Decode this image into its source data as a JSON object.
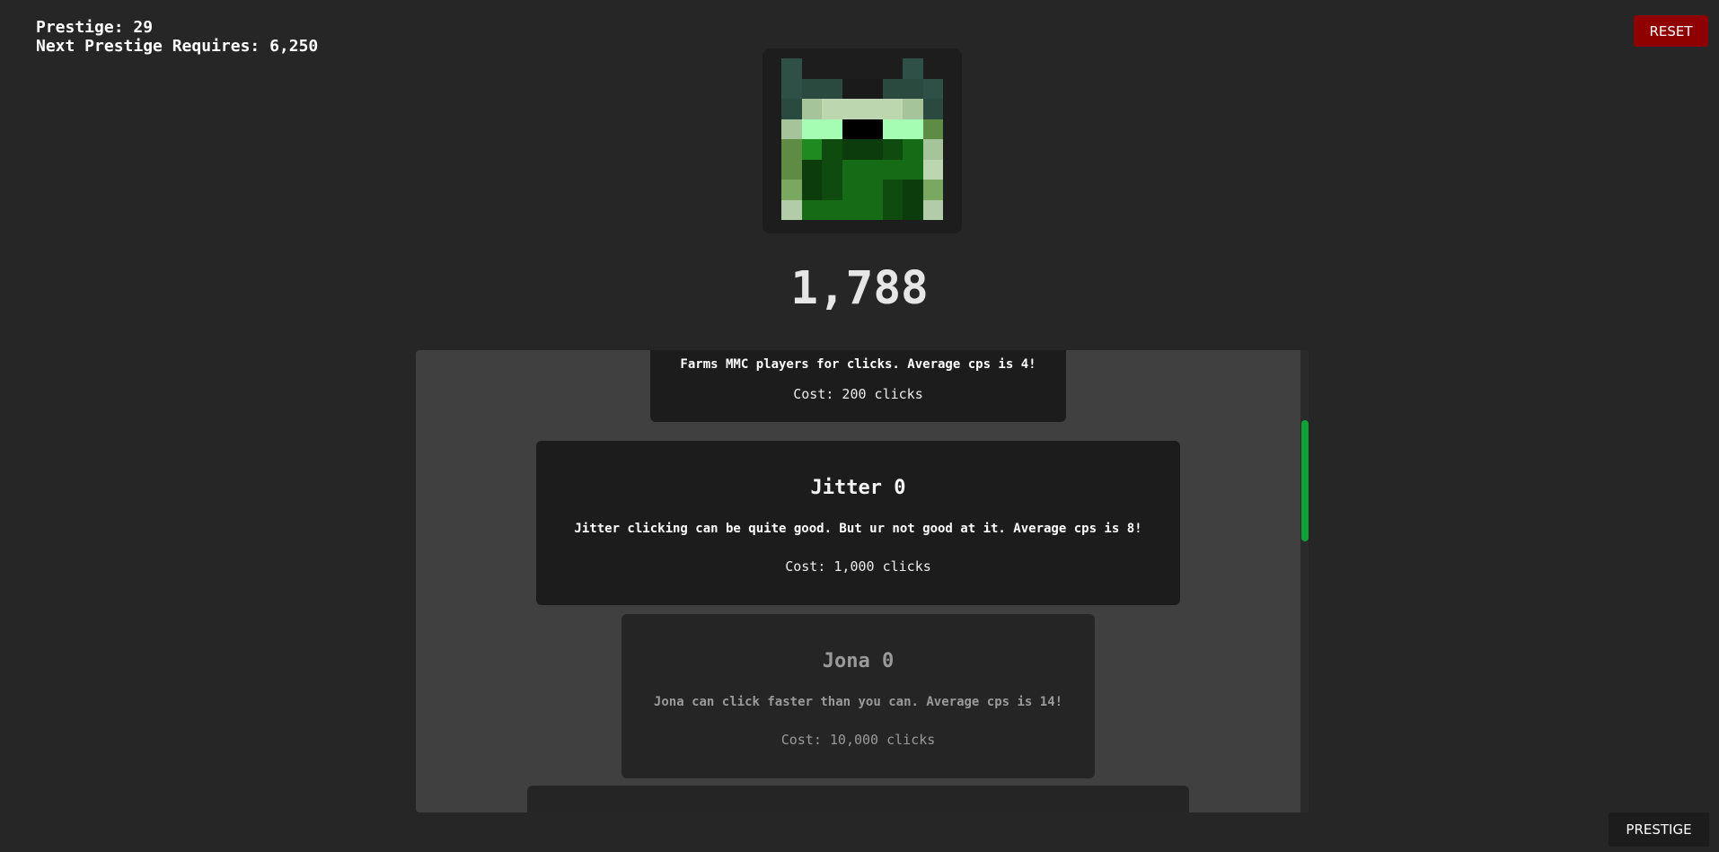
{
  "header": {
    "prestige_label": "Prestige: 29",
    "next_prestige_label": "Next Prestige Requires: 6,250"
  },
  "buttons": {
    "reset_label": "RESET",
    "prestige_label": "PRESTIGE"
  },
  "clicker": {
    "icon": "creeper-head-icon",
    "count": "1,788",
    "pixel_colors": [
      [
        "#2e5047",
        "#1d1d1d",
        "#1d1d1d",
        "#1d1d1d",
        "#1d1d1d",
        "#1d1d1d",
        "#2e5047",
        "#1d1d1d"
      ],
      [
        "#2e5047",
        "#2a4a40",
        "#2a4a40",
        "#1a1a1a",
        "#1a1a1a",
        "#2a4a40",
        "#2a4a40",
        "#2e5047"
      ],
      [
        "#2a4a40",
        "#a6c49a",
        "#bcd7b0",
        "#bcd7b0",
        "#bcd7b0",
        "#bcd7b0",
        "#a6c49a",
        "#2a4a40"
      ],
      [
        "#a6c49a",
        "#a5fcb3",
        "#a5fcb3",
        "#000000",
        "#000000",
        "#a5fcb3",
        "#a5fcb3",
        "#5f8c44"
      ],
      [
        "#5f8c44",
        "#1f8a1f",
        "#0f4a0f",
        "#0c3c0c",
        "#0c3c0c",
        "#0f4a0f",
        "#166b16",
        "#a6c49a"
      ],
      [
        "#5f8c44",
        "#0c3c0c",
        "#0f4a0f",
        "#166b16",
        "#166b16",
        "#166b16",
        "#166b16",
        "#bcd7b0"
      ],
      [
        "#7aa860",
        "#0c3c0c",
        "#0f4a0f",
        "#166b16",
        "#166b16",
        "#0f4a0f",
        "#0c3c0c",
        "#7aa860"
      ],
      [
        "#b2cba8",
        "#166b16",
        "#166b16",
        "#166b16",
        "#166b16",
        "#0f4a0f",
        "#0c3c0c",
        "#b2cba8"
      ]
    ]
  },
  "shop": {
    "scroll_accent": "#10a038",
    "upgrades": [
      {
        "name": "",
        "desc": "Farms MMC players for clicks. Average cps is 4!",
        "cost": "Cost: 200 clicks"
      },
      {
        "name": "Jitter 0",
        "desc": "Jitter clicking can be quite good. But ur not good at it. Average cps is 8!",
        "cost": "Cost: 1,000 clicks"
      },
      {
        "name": "Jona 0",
        "desc": "Jona can click faster than you can. Average cps is 14!",
        "cost": "Cost: 10,000 clicks"
      }
    ]
  },
  "colors": {
    "background": "#262626",
    "reset": "#8f0000",
    "panel": "#404040",
    "card": "#1c1c1c"
  }
}
